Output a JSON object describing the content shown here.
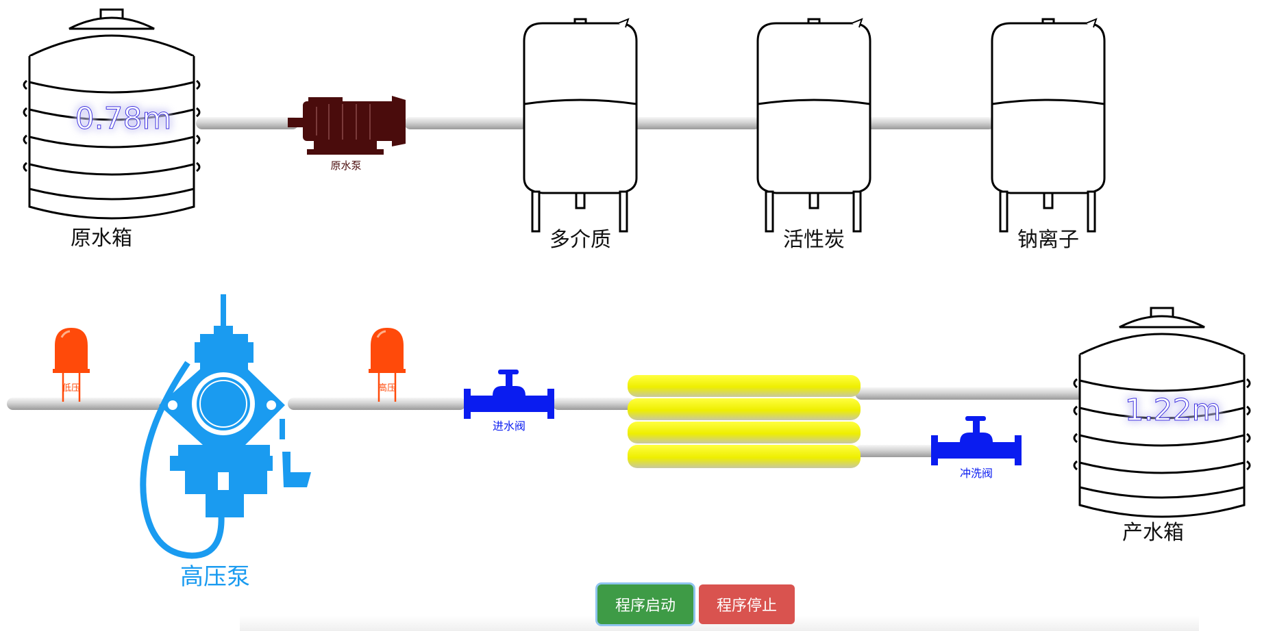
{
  "raw_tank": {
    "label": "原水箱",
    "level": "0.78m"
  },
  "raw_pump": {
    "label": "原水泵"
  },
  "filters": [
    {
      "label": "多介质"
    },
    {
      "label": "活性炭"
    },
    {
      "label": "钠离子"
    }
  ],
  "low_pressure_lamp": {
    "label": "低压"
  },
  "high_pressure_lamp": {
    "label": "高压"
  },
  "hp_pump": {
    "label": "高压泵"
  },
  "inlet_valve": {
    "label": "进水阀"
  },
  "flush_valve": {
    "label": "冲洗阀"
  },
  "product_tank": {
    "label": "产水箱",
    "level": "1.22m"
  },
  "controls": {
    "start": "程序启动",
    "stop": "程序停止"
  },
  "colors": {
    "pump_motor": "#4a0c0c",
    "hp_pump": "#1a9bf0",
    "valve": "#0a1cf0",
    "lamp": "#ff4a0a",
    "membrane": "#f0f000",
    "pipe": "#c9c9c9",
    "start_button": "#3e9b46",
    "stop_button": "#d9534f"
  }
}
